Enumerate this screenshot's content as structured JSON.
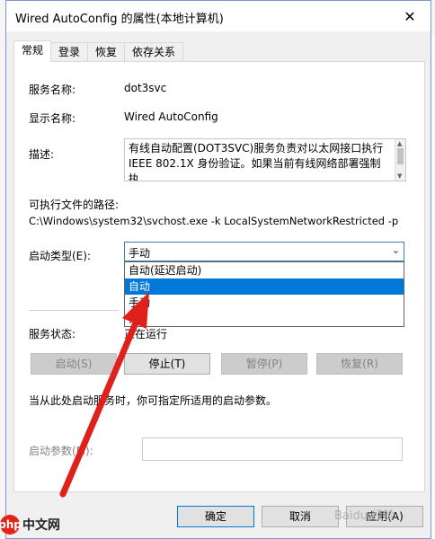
{
  "window": {
    "title": "Wired AutoConfig 的属性(本地计算机)",
    "close_glyph": "✕"
  },
  "tabs": [
    "常规",
    "登录",
    "恢复",
    "依存关系"
  ],
  "general": {
    "service_name_label": "服务名称:",
    "service_name_value": "dot3svc",
    "display_name_label": "显示名称:",
    "display_name_value": "Wired AutoConfig",
    "description_label": "描述:",
    "description_value": "有线自动配置(DOT3SVC)服务负责对以太网接口执行\nIEEE 802.1X 身份验证。如果当前有线网络部署强制执",
    "exe_path_label": "可执行文件的路径:",
    "exe_path_value": "C:\\Windows\\system32\\svchost.exe -k LocalSystemNetworkRestricted -p",
    "startup_type_label": "启动类型(E):",
    "startup_type_value": "手动",
    "startup_options": [
      "自动(延迟启动)",
      "自动",
      "手动",
      "禁用"
    ],
    "startup_options_visible": [
      "自动(延迟启动)",
      "自动",
      "手动",
      "禁"
    ],
    "startup_selected_index": 1,
    "service_status_label": "服务状态:",
    "service_status_value": "正在运行",
    "service_status_visible": "正在运行",
    "buttons": {
      "start": "启动(S)",
      "stop": "停止(T)",
      "pause": "暂停(P)",
      "resume": "恢复(R)"
    },
    "hint": "当从此处启动服务时，你可指定所适用的启动参数。",
    "start_params_label": "启动参数(M):",
    "start_params_value": ""
  },
  "footer": {
    "ok": "确定",
    "cancel": "取消",
    "apply": "应用(A)"
  },
  "watermarks": {
    "left_logo": "php",
    "left_text": "中文网",
    "right_text": "Baidu 经验"
  },
  "colors": {
    "accent": "#0078d7",
    "arrow": "#e0201b",
    "dialog_border": "#7a9ac9"
  }
}
